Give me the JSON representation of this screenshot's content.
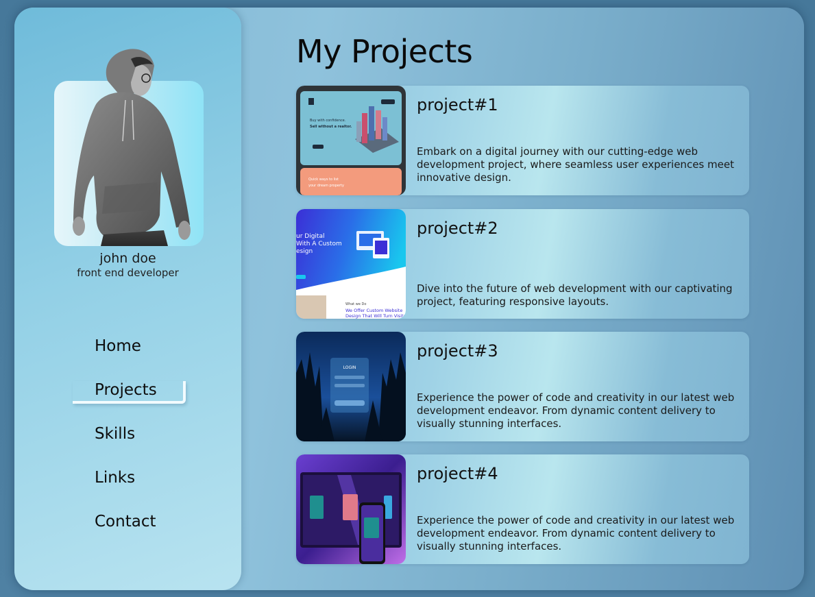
{
  "profile": {
    "name": "john doe",
    "role": "front end developer"
  },
  "nav": {
    "items": [
      {
        "label": "Home"
      },
      {
        "label": "Projects"
      },
      {
        "label": "Skills"
      },
      {
        "label": "Links"
      },
      {
        "label": "Contact"
      }
    ],
    "active": "Projects"
  },
  "main": {
    "title": "My Projects",
    "projects": [
      {
        "title": "project#1",
        "description": "Embark on a digital journey with our cutting-edge web development project, where seamless user experiences meet innovative design.",
        "thumbnail": {
          "hero_line1": "Buy with confidence.",
          "hero_line2": "Sell without a realtor.",
          "cta": "Quick ways to list",
          "cta2": "your dream property"
        }
      },
      {
        "title": "project#2",
        "description": "Dive into the future of web development with our captivating project, featuring responsive layouts.",
        "thumbnail": {
          "hero_line1": "ur Digital",
          "hero_line2": "With A Custom",
          "hero_line3": "esign",
          "sub": "What we Do",
          "cta": "We Offer Custom Website",
          "cta2": "Design That Will Turn Visitors"
        }
      },
      {
        "title": "project#3",
        "description": "Experience the power of code and creativity in our latest web development endeavor. From dynamic content delivery to visually stunning interfaces.",
        "thumbnail": {
          "login": "LOGIN"
        }
      },
      {
        "title": "project#4",
        "description": "Experience the power of code and creativity in our latest web development endeavor. From dynamic content delivery to visually stunning interfaces.",
        "thumbnail": {}
      }
    ]
  },
  "colors": {
    "background": "#4f81a3",
    "sidebar": "#93d0e6",
    "accent_card": "#9fd2e6",
    "text": "#111111"
  }
}
